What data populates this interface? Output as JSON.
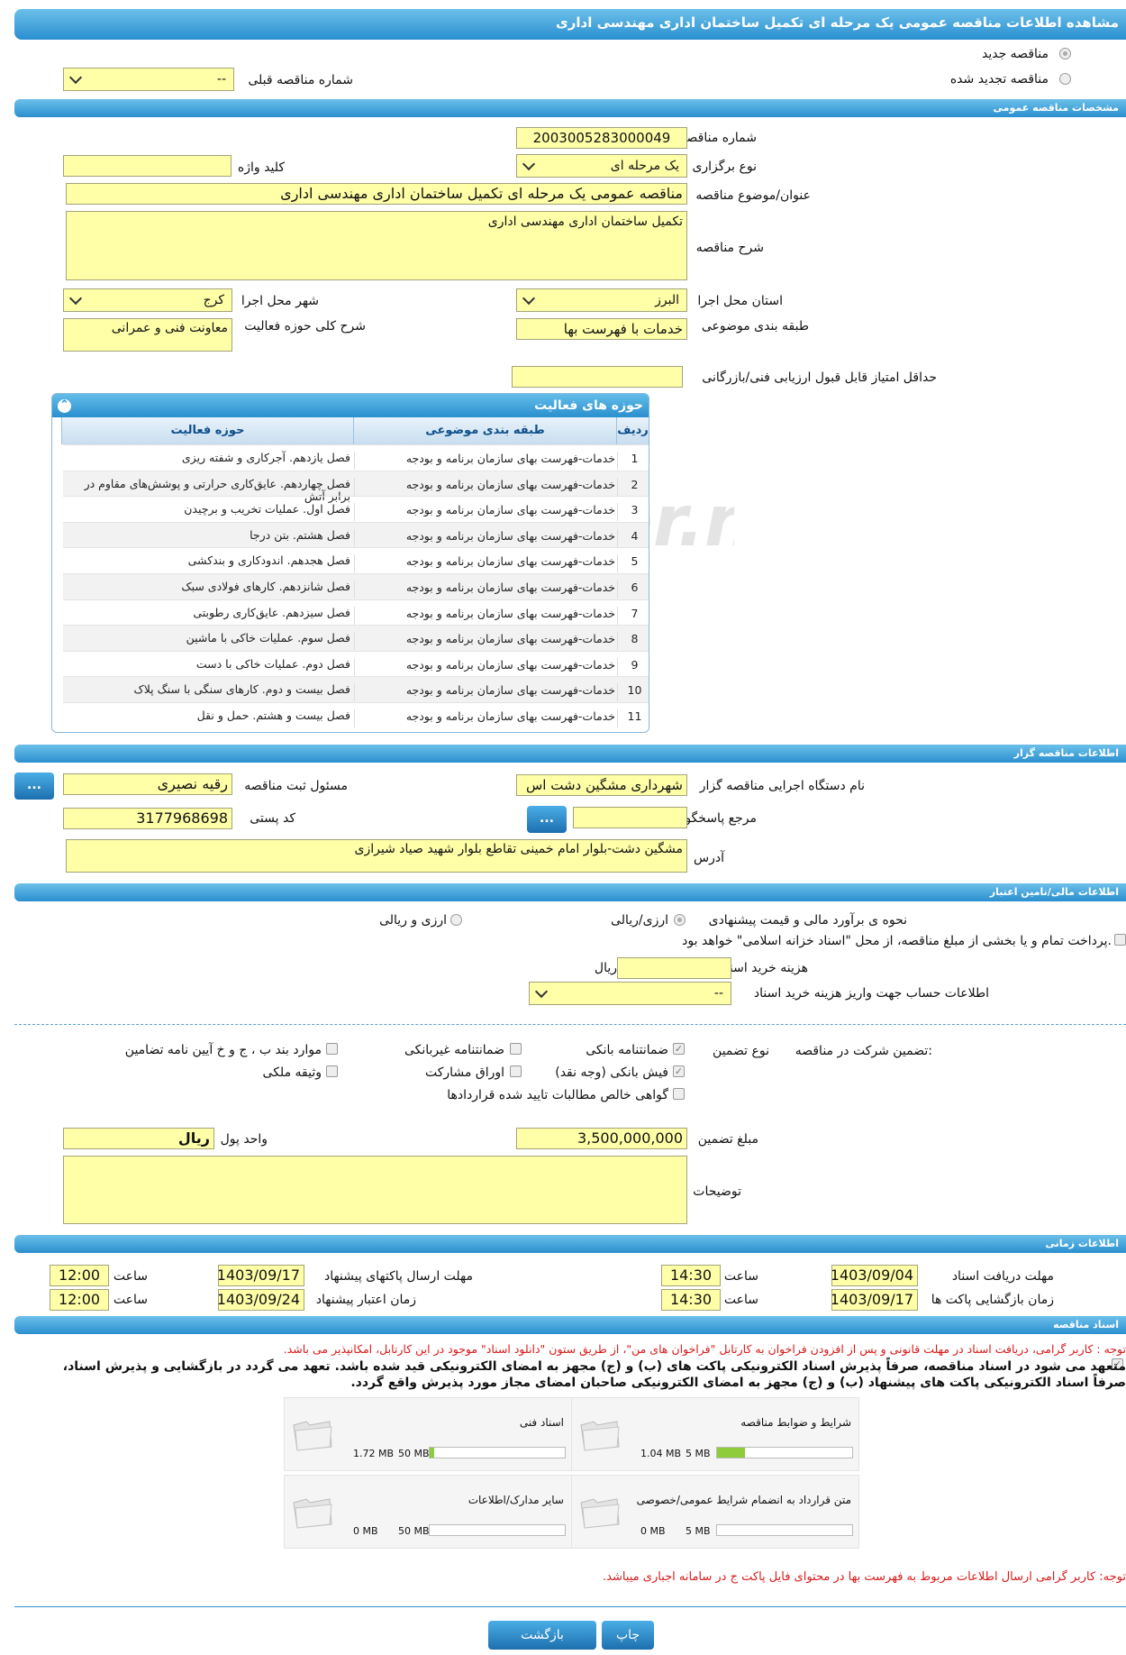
{
  "title": "مشاهده اطلاعات مناقصه عمومی یک مرحله ای تکمیل ساختمان اداری مهندسی اداری",
  "top": {
    "new_label": "مناقصه جدید",
    "renew_label": "مناقصه تجدید شده",
    "prev_label": "شماره مناقصه قبلی",
    "prev_value": "--"
  },
  "sections": {
    "general": "مشخصات مناقصه عمومی",
    "organizer": "اطلاعات مناقصه گزار",
    "finance": "اطلاعات مالی/تامین اعتبار",
    "time": "اطلاعات زمانی",
    "docs": "اسناد مناقصه"
  },
  "general": {
    "number_label": "شماره مناقصه",
    "number": "2003005283000049",
    "type_label": "نوع برگزاری",
    "type": "یک مرحله ای",
    "keyword_label": "کلید واژه",
    "keyword": "",
    "subject_label": "عنوان/موضوع مناقصه",
    "subject": "مناقصه عمومی یک مرحله ای تکمیل ساختمان اداری مهندسی اداری",
    "desc_label": "شرح مناقصه",
    "desc": "تکمیل ساختمان اداری مهندسی اداری",
    "province_label": "استان محل اجرا",
    "province": "البرز",
    "city_label": "شهر محل اجرا",
    "city": "کرج",
    "category_label": "طبقه بندی موضوعی",
    "category": "خدمات با فهرست بها",
    "scope_label": "شرح کلی حوزه فعالیت",
    "scope": "معاونت فنی و عمرانی",
    "min_score_label": "حداقل امتیاز قابل قبول ارزیابی فنی/بازرگانی",
    "min_score": ""
  },
  "grid": {
    "title": "حوزه های فعالیت",
    "cols": [
      "ردیف",
      "طبقه بندی موضوعی",
      "حوزه فعالیت"
    ],
    "rows": [
      {
        "n": "1",
        "cat": "خدمات-فهرست بهای سازمان برنامه و بودجه",
        "area": "فصل یازدهم. آجرکاری و شفته ریزی"
      },
      {
        "n": "2",
        "cat": "خدمات-فهرست بهای سازمان برنامه و بودجه",
        "area": "فصل چهاردهم. عایق‌کاری حرارتی و پوشش‌های مقاوم در برابر آتش"
      },
      {
        "n": "3",
        "cat": "خدمات-فهرست بهای سازمان برنامه و بودجه",
        "area": "فصل اول. عملیات تخریب و برچیدن"
      },
      {
        "n": "4",
        "cat": "خدمات-فهرست بهای سازمان برنامه و بودجه",
        "area": "فصل هشتم. بتن درجا"
      },
      {
        "n": "5",
        "cat": "خدمات-فهرست بهای سازمان برنامه و بودجه",
        "area": "فصل هجدهم. اندودکاری و بندکشی"
      },
      {
        "n": "6",
        "cat": "خدمات-فهرست بهای سازمان برنامه و بودجه",
        "area": "فصل شانزدهم. کارهای فولادی سبک"
      },
      {
        "n": "7",
        "cat": "خدمات-فهرست بهای سازمان برنامه و بودجه",
        "area": "فصل سیزدهم. عایق‌کاری رطوبتی"
      },
      {
        "n": "8",
        "cat": "خدمات-فهرست بهای سازمان برنامه و بودجه",
        "area": "فصل سوم. عملیات خاکی با ماشین"
      },
      {
        "n": "9",
        "cat": "خدمات-فهرست بهای سازمان برنامه و بودجه",
        "area": "فصل دوم. عملیات خاکی با دست"
      },
      {
        "n": "10",
        "cat": "خدمات-فهرست بهای سازمان برنامه و بودجه",
        "area": "فصل بیست و دوم. کارهای سنگی با سنگ پلاک"
      },
      {
        "n": "11",
        "cat": "خدمات-فهرست بهای سازمان برنامه و بودجه",
        "area": "فصل بیست و هشتم. حمل و نقل"
      }
    ]
  },
  "organizer": {
    "org_label": "نام دستگاه اجرایی مناقصه گزار",
    "org": "شهرداری مشگین دشت اس",
    "resp_label": "مسئول ثبت مناقصه",
    "resp": "رقیه نصیری",
    "ref_label": "مرجع پاسخگویی",
    "ref": "",
    "postal_label": "کد پستی",
    "postal": "3177968698",
    "addr_label": "آدرس",
    "addr": "مشگین دشت-بلوار امام خمینی تقاطع بلوار شهید صیاد شیرازی",
    "dots": "..."
  },
  "finance": {
    "method_label": "نحوه ی برآورد مالی و قیمت پیشنهادی",
    "opt1": "ارزی/ریالی",
    "opt2": "ارزی و ریالی",
    "treasury": "پرداخت تمام و یا بخشی از مبلغ مناقصه، از محل \"اسناد خزانه اسلامی\" خواهد بود.",
    "doc_cost_label": "هزینه خرید اسناد",
    "doc_cost": "",
    "doc_cost_unit": "ریال",
    "account_label": "اطلاعات حساب جهت واریز هزینه خرید اسناد",
    "account": "--"
  },
  "guarantee": {
    "label": "تضمین شرکت در مناقصه:",
    "type_label": "نوع تضمین",
    "items": [
      "ضمانتنامه بانکی",
      "ضمانتنامه غیربانکی",
      "موارد بند ب ، ج و خ آیین نامه تضامین",
      "فیش بانکی (وجه نقد)",
      "اوراق مشارکت",
      "وثیقه ملکی",
      "گواهی خالص مطالبات تایید شده قراردادها"
    ],
    "amount_label": "مبلغ تضمین",
    "amount": "3,500,000,000",
    "unit_label": "واحد پول",
    "unit": "ریال",
    "notes_label": "توضیحات",
    "notes": ""
  },
  "time": {
    "receive_label": "مهلت دریافت اسناد",
    "receive_date": "1403/09/04",
    "receive_time": "14:30",
    "send_label": "مهلت ارسال پاکتهای پیشنهاد",
    "send_date": "1403/09/17",
    "send_time": "12:00",
    "open_label": "زمان بازگشایی پاکت ها",
    "open_date": "1403/09/17",
    "open_time": "14:30",
    "valid_label": "زمان اعتبار پیشنهاد",
    "valid_date": "1403/09/24",
    "valid_time": "12:00",
    "hour_label": "ساعت"
  },
  "docs": {
    "note1": "توجه : کاربر گرامی، دریافت اسناد در مهلت قانونی و پس از افزودن فراخوان به کارتابل \"فراخوان های من\"، از طریق ستون \"دانلود اسناد\" موجود در این کارتابل، امکانپذیر می باشد.",
    "note2": "متعهد می شود در اسناد مناقصه، صرفاً پذیرش اسناد الکترونیکی پاکت های (ب) و (ج) مجهز به امضای الکترونیکی قید شده باشد. تعهد می گردد در بازگشایی و پذیرش اسناد،",
    "note3": "صرفاً اسناد الکترونیکی پاکت های پیشنهاد (ب) و (ج) مجهز به امضای الکترونیکی صاحبان امضای مجاز مورد پذیرش واقع گردد.",
    "files": [
      {
        "name": "شرایط و ضوابط مناقصه",
        "size": "1.04 MB",
        "max": "5 MB",
        "fill": 0.208
      },
      {
        "name": "اسناد فنی",
        "size": "1.72 MB",
        "max": "50 MB",
        "fill": 0.034
      },
      {
        "name": "متن قرارداد به انضمام شرایط عمومی/خصوصی",
        "size": "0 MB",
        "max": "5 MB",
        "fill": 0
      },
      {
        "name": "سایر مدارک/اطلاعات",
        "size": "0 MB",
        "max": "50 MB",
        "fill": 0
      }
    ],
    "note4": "توجه: کاربر گرامی ارسال اطلاعات مربوط به فهرست بها در محتوای فایل پاکت ج در سامانه اجباری میباشد."
  },
  "buttons": {
    "back": "بازگشت",
    "print": "چاپ"
  },
  "colors": {
    "bar": "#2a8fcf",
    "field": "#ffffa8",
    "note_red": "#d81b1b"
  }
}
